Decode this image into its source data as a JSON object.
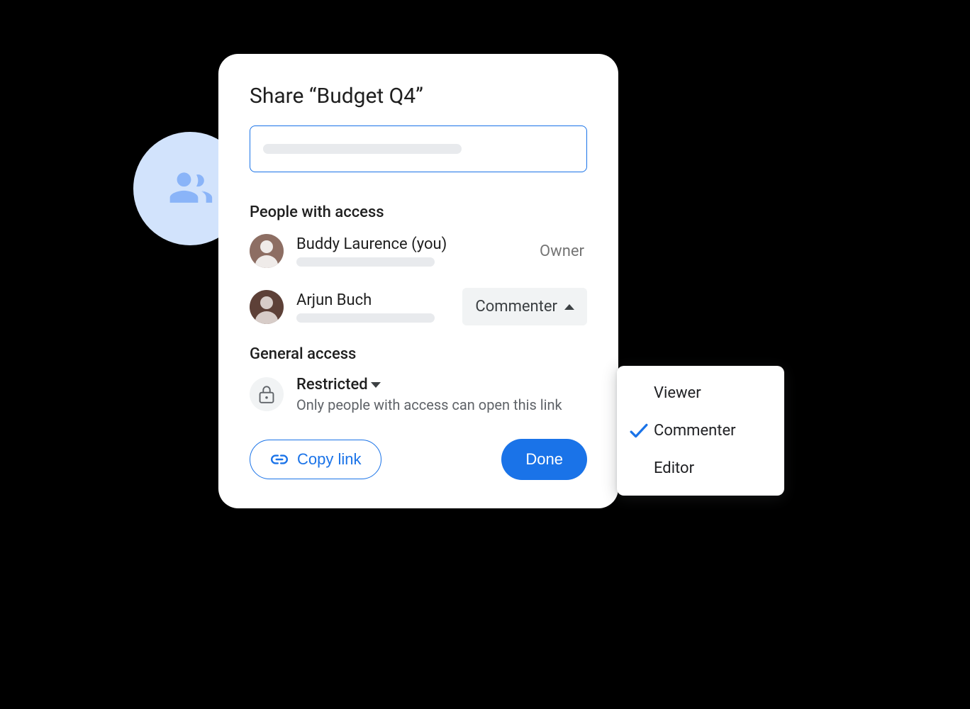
{
  "dialog": {
    "title": "Share “Budget Q4”",
    "sections": {
      "people_label": "People with access",
      "general_label": "General access"
    },
    "people": [
      {
        "name": "Buddy Laurence (you)",
        "role": "Owner",
        "role_editable": false
      },
      {
        "name": "Arjun Buch",
        "role": "Commenter",
        "role_editable": true
      }
    ],
    "general_access": {
      "level": "Restricted",
      "description": "Only people with access can open this link"
    },
    "role_options": [
      {
        "label": "Viewer",
        "selected": false
      },
      {
        "label": "Commenter",
        "selected": true
      },
      {
        "label": "Editor",
        "selected": false
      }
    ],
    "buttons": {
      "copy_link": "Copy link",
      "done": "Done"
    }
  }
}
